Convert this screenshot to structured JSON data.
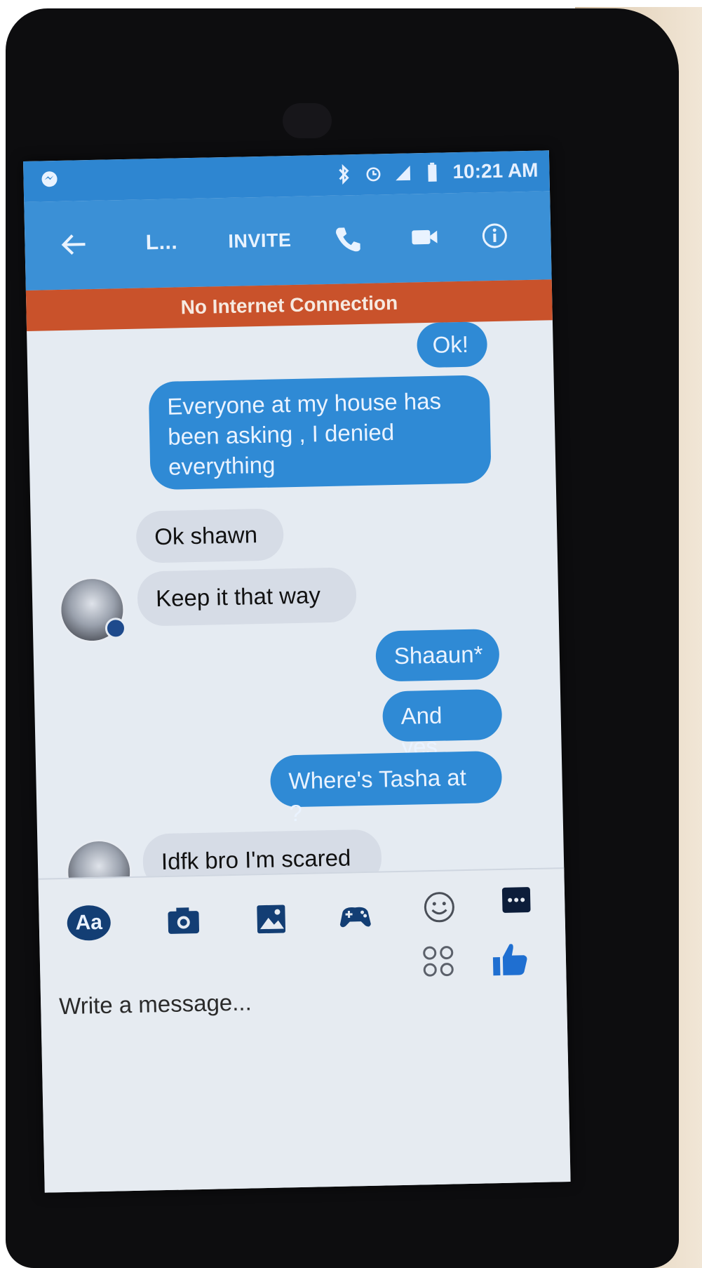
{
  "status_bar": {
    "time": "10:21 AM",
    "icons": [
      "messenger-bubble-icon",
      "bluetooth-icon",
      "alarm-icon",
      "signal-icon",
      "battery-icon"
    ]
  },
  "toolbar": {
    "back_icon": "arrow-left-icon",
    "name_placeholder": "L...",
    "invite_label": "INVITE",
    "call_icon": "phone-icon",
    "video_icon": "video-camera-icon",
    "info_icon": "info-circle-icon"
  },
  "banner": {
    "text": "No Internet Connection"
  },
  "messages": [
    {
      "from": "me",
      "text": "Ok!"
    },
    {
      "from": "me",
      "text": "Everyone at my house has been asking , I denied everything"
    },
    {
      "from": "them",
      "text": "Ok shawn"
    },
    {
      "from": "them",
      "text": "Keep it that way"
    },
    {
      "from": "me",
      "text": "Shaaun*"
    },
    {
      "from": "me",
      "text": "And yes"
    },
    {
      "from": "me",
      "text": "Where's Tasha at ?"
    },
    {
      "from": "them",
      "text": "Idfk bro I'm scared"
    }
  ],
  "composer": {
    "aa_label": "Aa",
    "tools": [
      "camera-icon",
      "image-icon",
      "gamepad-icon",
      "smiley-icon",
      "more-icon"
    ],
    "placeholder": "Write a message...",
    "like_icon": "thumbs-up-icon"
  },
  "colors": {
    "header_blue": "#3b90d6",
    "banner_orange": "#c9522b",
    "my_bubble": "#2f8ad5",
    "their_bubble": "#d6dce6"
  }
}
